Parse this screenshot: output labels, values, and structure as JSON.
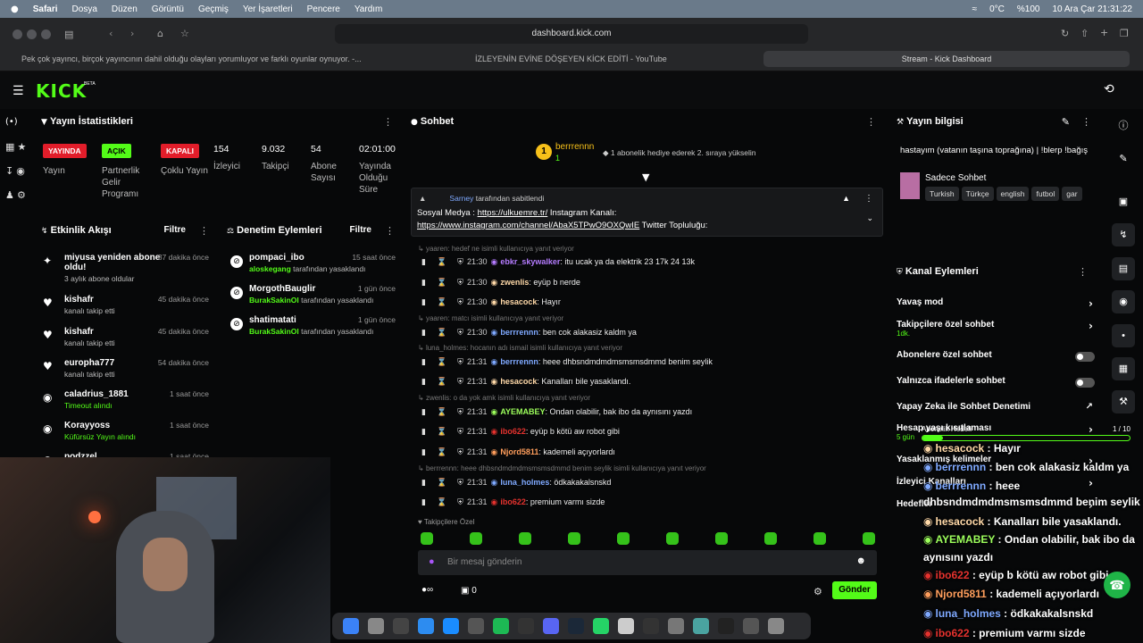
{
  "menubar": {
    "items": [
      "Safari",
      "Dosya",
      "Düzen",
      "Görüntü",
      "Geçmiş",
      "Yer İşaretleri",
      "Pencere",
      "Yardım"
    ],
    "temp": "0°C",
    "battery": "%100",
    "datetime": "10 Ara Çar  21:31:22"
  },
  "browser": {
    "url": "dashboard.kick.com",
    "tabs": [
      "Pek çok yayıncı, birçok yayıncının dahil olduğu olayları yorumluyor ve farklı oyunlar oynuyor. -...",
      "İZLEYENİN EVİNE DÖŞEYEN KİCK EDİTİ - YouTube",
      "Stream - Kick Dashboard"
    ]
  },
  "brand": {
    "logo": "KICK",
    "beta": "BETA"
  },
  "stats": {
    "title": "Yayın İstatistikleri",
    "items": [
      {
        "badge": "YAYINDA",
        "label": "Yayın"
      },
      {
        "badge": "AÇIK",
        "label": "Partnerlik Gelir Programı"
      },
      {
        "badge": "KAPALI",
        "label": "Çoklu Yayın"
      }
    ],
    "values": [
      {
        "value": "154",
        "label": "İzleyici"
      },
      {
        "value": "9.032",
        "label": "Takipçi"
      },
      {
        "value": "54",
        "label": "Abone Sayısı"
      },
      {
        "value": "02:01:00",
        "label": "Yayında Olduğu Süre"
      }
    ]
  },
  "activity": {
    "title": "Etkinlik Akışı",
    "filter": "Filtre",
    "items": [
      {
        "name": "miyusa yeniden abone oldu!",
        "sub": "3 aylık abone oldular",
        "time": "37 dakika önce"
      },
      {
        "name": "kishafr",
        "sub": "kanalı takip etti",
        "time": "45 dakika önce"
      },
      {
        "name": "kishafr",
        "sub": "kanalı takip etti",
        "time": "45 dakika önce"
      },
      {
        "name": "europha777",
        "sub": "kanalı takip etti",
        "time": "54 dakika önce"
      },
      {
        "name": "caladrius_1881",
        "sub": "Timeout alındı",
        "time": "1 saat önce"
      },
      {
        "name": "Korayyoss",
        "sub": "Küfürsüz Yayın alındı",
        "time": "1 saat önce"
      },
      {
        "name": "podzzel",
        "sub": "",
        "time": "1 saat önce"
      }
    ]
  },
  "moderation": {
    "title": "Denetim Eylemleri",
    "filter": "Filtre",
    "items": [
      {
        "name": "pompaci_ibo",
        "by": "aloskegang",
        "rest": " tarafından yasaklandı",
        "time": "15 saat önce"
      },
      {
        "name": "MorgothBauglir",
        "by": "BurakSakinOl",
        "rest": " tarafından yasaklandı",
        "time": "1 gün önce"
      },
      {
        "name": "shatimatati",
        "by": "BurakSakinOl",
        "rest": " tarafından yasaklandı",
        "time": "1 gün önce"
      }
    ]
  },
  "chat": {
    "title": "Sohbet",
    "top_user": "berrrennn",
    "top_count": "1",
    "gift_text": "1 abonelik hediye ederek 2. sıraya yükselin",
    "pinned": {
      "by": "Sarney",
      "by_rest": " tarafından sabitlendi",
      "line1": "Sosyal Medya : ",
      "link1": "https://ulkuemre.tr/",
      "line1b": " Instagram Kanalı:",
      "link2": "https://www.instagram.com/channel/AbaX5TPwO9OXQwIE",
      "line2b": " Twitter Topluluğu:"
    },
    "messages": [
      {
        "reply": "yaaren: hedef ne isimli kullanıcıya yanıt veriyor",
        "time": "21:30",
        "user": "ebkr_skywalker",
        "color": "#b57cff",
        "text": ": itu ucak ya da elektrik 23 17k 24 13k"
      },
      {
        "reply": "",
        "time": "21:30",
        "user": "zwenlis",
        "color": "#ffd9a8",
        "text": ": eyüp b nerde"
      },
      {
        "reply": "",
        "time": "21:30",
        "user": "hesacock",
        "color": "#ffd9a8",
        "text": ": Hayır"
      },
      {
        "reply": "yaaren: matcı isimli kullanıcıya yanıt veriyor",
        "time": "21:30",
        "user": "berrrennn",
        "color": "#7fa9ff",
        "text": ": ben cok alakasiz kaldm ya"
      },
      {
        "reply": "luna_holmes: hocanın adı ismail isimli kullanıcıya yanıt veriyor",
        "time": "21:31",
        "user": "berrrennn",
        "color": "#7fa9ff",
        "text": ": heee dhbsndmdmdmsmsmsdmmd benim seylik"
      },
      {
        "reply": "",
        "time": "21:31",
        "user": "hesacock",
        "color": "#ffd9a8",
        "text": ": Kanalları bile yasaklandı."
      },
      {
        "reply": "zwenlis: o da yok amk isimli kullanıcıya yanıt veriyor",
        "time": "21:31",
        "user": "AYEMABEY",
        "color": "#9dff5c",
        "text": ": Ondan olabilir, bak ibo da aynısını yazdı"
      },
      {
        "reply": "",
        "time": "21:31",
        "user": "ibo622",
        "color": "#e5322e",
        "text": ": eyüp b kötü aw robot gibi"
      },
      {
        "reply": "",
        "time": "21:31",
        "user": "Njord5811",
        "color": "#ff9e5c",
        "text": ": kademeli açıyorlardı"
      },
      {
        "reply": "berrrennn: heee dhbsndmdmdmsmsmsdmmd benim seylik isimli kullanıcıya yanıt veriyor",
        "time": "21:31",
        "user": "luna_holmes",
        "color": "#7fa9ff",
        "text": ": ödkakakalsnskd"
      },
      {
        "reply": "",
        "time": "21:31",
        "user": "ibo622",
        "color": "#e5322e",
        "text": ": premium varmı sizde"
      }
    ],
    "followers_only": "Takipçilere Özel",
    "placeholder": "Bir mesaj gönderin",
    "count": "0",
    "send": "Gönder"
  },
  "stream_info": {
    "title": "Yayın bilgisi",
    "stream_title": "hastayım (vatanın taşına toprağına) | !blerp !bağış",
    "category": "Sadece Sohbet",
    "tags": [
      "Turkish",
      "Türkçe",
      "english",
      "futbol",
      "gar"
    ]
  },
  "channel_actions": {
    "title": "Kanal Eylemleri",
    "items": [
      {
        "label": "Yavaş mod",
        "sub": "",
        "kind": "arrow"
      },
      {
        "label": "Takipçilere özel sohbet",
        "sub": "1dk.",
        "kind": "arrow"
      },
      {
        "label": "Abonelere özel sohbet",
        "sub": "",
        "kind": "toggle"
      },
      {
        "label": "Yalnızca ifadelerle sohbet",
        "sub": "",
        "kind": "toggle"
      },
      {
        "label": "Yapay Zeka ile Sohbet Denetimi",
        "sub": "",
        "kind": "ext"
      },
      {
        "label": "Hesap yaşı kısıtlaması",
        "sub": "5 gün",
        "kind": "arrow"
      },
      {
        "label": "Yasaklanmış kelimeler",
        "sub": "",
        "kind": "arrow"
      },
      {
        "label": "İzleyici Kanalları",
        "sub": "",
        "kind": "arrow"
      },
      {
        "label": "Hedefler",
        "sub": "",
        "kind": "arrow"
      }
    ]
  },
  "overlay": {
    "goal_label": "Abonelik Hedefi",
    "goal_count": "1 / 10",
    "goal_progress": 0.1,
    "lines": [
      {
        "user": "hesacock",
        "text": " : Hayır",
        "color": "#ffd9a8"
      },
      {
        "user": "berrrennn",
        "text": " : ben cok alakasiz kaldm ya",
        "color": "#7fa9ff"
      },
      {
        "user": "berrrennn",
        "text": " : heee",
        "color": "#7fa9ff"
      },
      {
        "user": "",
        "text": "dhbsndmdmdmsmsmsdmmd benim seylik",
        "color": "#fff"
      },
      {
        "user": "hesacock",
        "text": " : Kanalları bile yasaklandı.",
        "color": "#ffd9a8"
      },
      {
        "user": "AYEMABEY",
        "text": " : Ondan olabilir, bak ibo da",
        "color": "#9dff5c"
      },
      {
        "user": "",
        "text": "aynısını yazdı",
        "color": "#fff"
      },
      {
        "user": "ibo622",
        "text": " : eyüp b kötü aw robot gibi",
        "color": "#e5322e"
      },
      {
        "user": "Njord5811",
        "text": " : kademeli açıyorlardı",
        "color": "#ff9e5c"
      },
      {
        "user": "luna_holmes",
        "text": " : ödkakakalsnskd",
        "color": "#7fa9ff"
      },
      {
        "user": "ibo622",
        "text": " : premium varmı sizde",
        "color": "#e5322e"
      }
    ]
  }
}
